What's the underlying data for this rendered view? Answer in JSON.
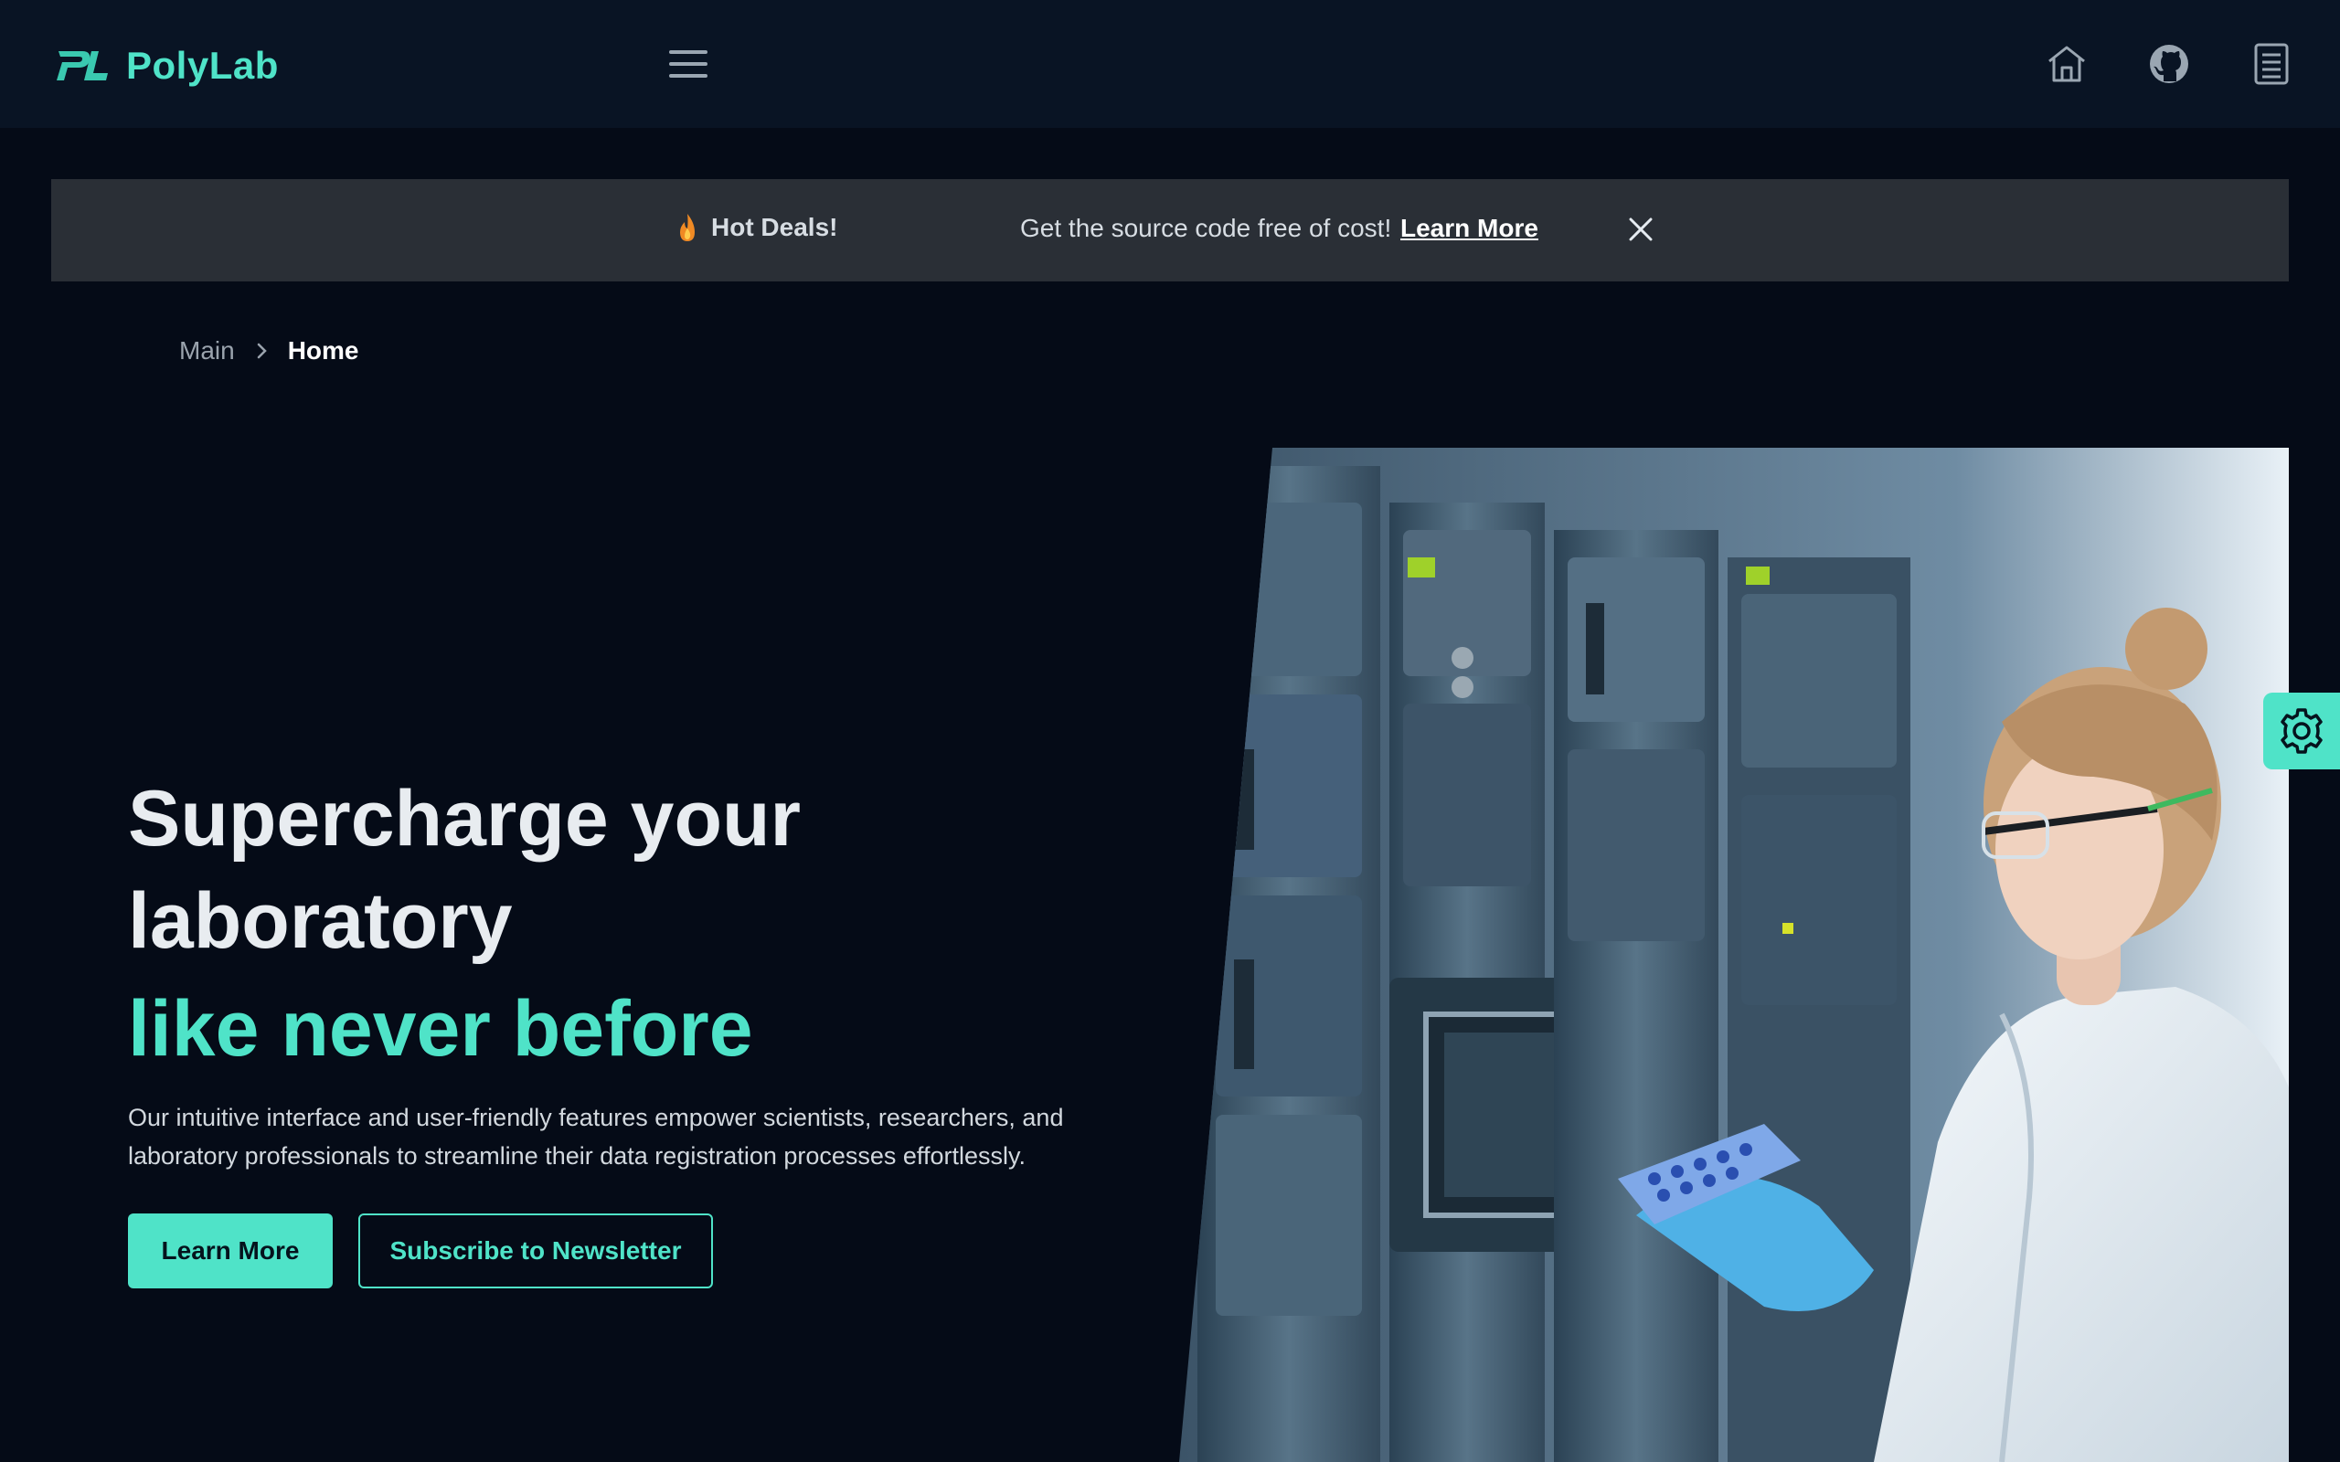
{
  "header": {
    "brand_name": "PolyLab",
    "icons": [
      "menu-icon",
      "home-icon",
      "github-icon",
      "docs-icon"
    ]
  },
  "banner": {
    "hot_label": "Hot Deals!",
    "message": "Get the source code free of cost!",
    "link_label": "Learn More"
  },
  "breadcrumb": {
    "parent": "Main",
    "current": "Home"
  },
  "hero": {
    "title_line1": "Supercharge your",
    "title_line2": "laboratory",
    "title_accent": "like never before",
    "description": "Our intuitive interface and user-friendly features empower scientists, researchers, and laboratory professionals to streamline their data registration processes effortlessly.",
    "primary_button": "Learn More",
    "secondary_button": "Subscribe to Newsletter"
  },
  "colors": {
    "accent": "#4fe3c8",
    "background": "#050b17",
    "header": "#091424",
    "banner": "#2a2f36"
  }
}
